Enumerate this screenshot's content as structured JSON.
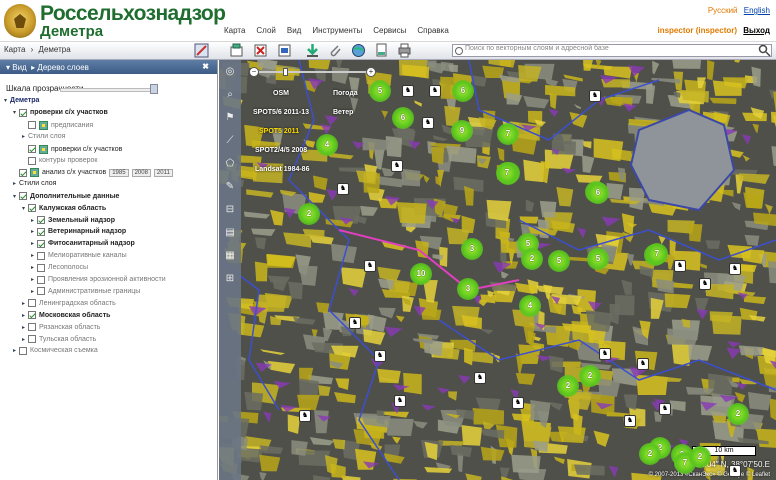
{
  "header": {
    "brand": "Россельхознадзор",
    "subtitle": "Деметра",
    "menu": [
      "Карта",
      "Слой",
      "Вид",
      "Инструменты",
      "Сервисы",
      "Справка"
    ],
    "languages": [
      "Русский",
      "English"
    ],
    "user": "inspector (inspector)",
    "logout": "Выход"
  },
  "toolbar": {
    "breadcrumb": [
      "Карта",
      "›",
      "Деметра"
    ],
    "search_placeholder": "Поиск по векторным слоям и адресной базе",
    "tool_icons": [
      "layer-add-icon",
      "layer-remove-icon",
      "layer-edit-icon",
      "download-icon",
      "attach-icon",
      "globe-icon",
      "print-preview-icon",
      "print-icon"
    ]
  },
  "sidebar": {
    "view_label": "Вид",
    "panel_title": "Дерево слоев",
    "close": "✖",
    "opacity_label": "Шкала прозрачности",
    "tree": [
      {
        "label": "Деметра",
        "checked": null,
        "level": 0,
        "bold": true,
        "arrow": "▾"
      },
      {
        "label": "проверки с/х участков",
        "checked": true,
        "level": 1,
        "bold": true,
        "arrow": "▾"
      },
      {
        "label": "предписания",
        "checked": false,
        "level": 2,
        "bold": false,
        "arrow": "",
        "icon": true,
        "muted": true
      },
      {
        "label": "Стили слоя",
        "checked": null,
        "level": 2,
        "bold": false,
        "arrow": "▸",
        "muted": true
      },
      {
        "label": "проверки с/х участков",
        "checked": true,
        "level": 2,
        "bold": false,
        "arrow": "",
        "icon": true
      },
      {
        "label": "контуры проверок",
        "checked": false,
        "level": 2,
        "bold": false,
        "arrow": "",
        "muted": true
      },
      {
        "label": "анализ с/х участков",
        "checked": true,
        "level": 1,
        "bold": false,
        "arrow": "",
        "icon": true,
        "years": [
          "1985",
          "2008",
          "2011"
        ]
      },
      {
        "label": "Стили слоя",
        "checked": null,
        "level": 1,
        "bold": false,
        "arrow": "▸"
      },
      {
        "label": "Дополнительные данные",
        "checked": true,
        "level": 1,
        "bold": true,
        "arrow": "▾"
      },
      {
        "label": "Калужская область",
        "checked": true,
        "level": 2,
        "bold": true,
        "arrow": "▾"
      },
      {
        "label": "Земельный надзор",
        "checked": true,
        "level": 3,
        "bold": true,
        "arrow": "▸"
      },
      {
        "label": "Ветеринарный надзор",
        "checked": true,
        "level": 3,
        "bold": true,
        "arrow": "▸"
      },
      {
        "label": "Фитосанитарный надзор",
        "checked": true,
        "level": 3,
        "bold": true,
        "arrow": "▸"
      },
      {
        "label": "Мелиоративные каналы",
        "checked": false,
        "level": 3,
        "bold": false,
        "arrow": "▸",
        "muted": true
      },
      {
        "label": "Лесополосы",
        "checked": false,
        "level": 3,
        "bold": false,
        "arrow": "▸",
        "muted": true
      },
      {
        "label": "Проявления эрозионной активности",
        "checked": false,
        "level": 3,
        "bold": false,
        "arrow": "▸",
        "muted": true
      },
      {
        "label": "Административные границы",
        "checked": false,
        "level": 3,
        "bold": false,
        "arrow": "▸",
        "muted": true
      },
      {
        "label": "Ленинградская область",
        "checked": false,
        "level": 2,
        "bold": false,
        "arrow": "▸",
        "muted": true
      },
      {
        "label": "Московская область",
        "checked": true,
        "level": 2,
        "bold": true,
        "arrow": "▸"
      },
      {
        "label": "Рязанская область",
        "checked": false,
        "level": 2,
        "bold": false,
        "arrow": "▸",
        "muted": true
      },
      {
        "label": "Тульская область",
        "checked": false,
        "level": 2,
        "bold": false,
        "arrow": "▸",
        "muted": true
      },
      {
        "label": "Космическая съемка",
        "checked": false,
        "level": 1,
        "bold": false,
        "arrow": "▸",
        "muted": true
      }
    ]
  },
  "map": {
    "layers": [
      {
        "label": "OSM",
        "selected": false
      },
      {
        "label": "Погода",
        "selected": false
      },
      {
        "label": "SPOT5/6 2011-13",
        "selected": false
      },
      {
        "label": "Ветер",
        "selected": false
      },
      {
        "label": "SPOT5 2011",
        "selected": true
      },
      {
        "label": "SPOT2/4/5 2008",
        "selected": false
      },
      {
        "label": "Landsat 1984-86",
        "selected": false
      }
    ],
    "clusters": [
      "5",
      "6",
      "6",
      "9",
      "7",
      "4",
      "6",
      "7",
      "2",
      "7",
      "6",
      "7",
      "3",
      "5",
      "2",
      "5",
      "10",
      "9",
      "5",
      "7",
      "3",
      "2",
      "4",
      "2",
      "2",
      "2",
      "7",
      "2",
      "2",
      "2"
    ],
    "scale": "10 km",
    "coords": "N 5°2'24.04\" N, 38°07'50.E",
    "copyright": "© 2007-2013 «СканЭкс» © Geoeye © Leaflet"
  }
}
